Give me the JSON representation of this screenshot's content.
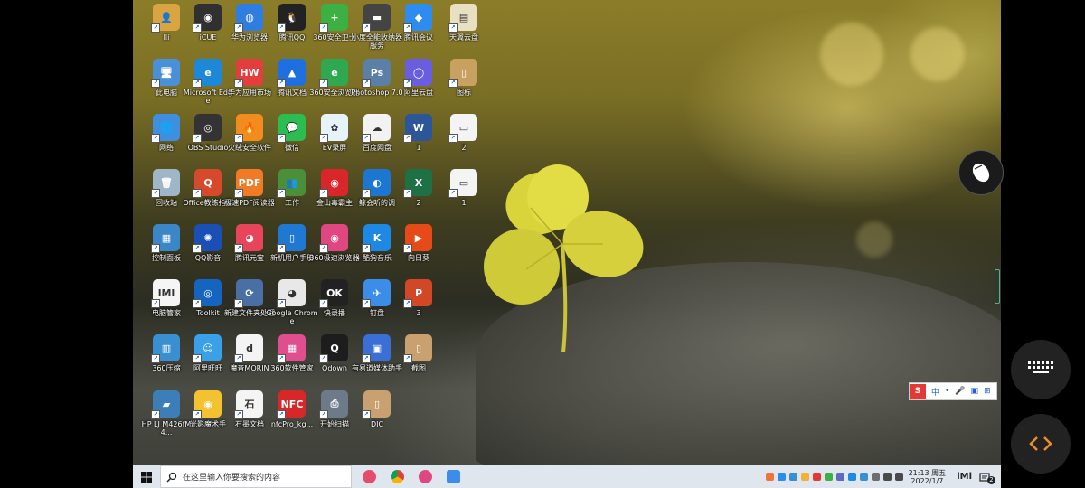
{
  "desktop": {
    "icons": [
      {
        "label": "lli",
        "color": "#d9a441",
        "glyph": "👤",
        "col": 0,
        "row": 0
      },
      {
        "label": "iCUE",
        "color": "#303030",
        "glyph": "◉",
        "col": 1,
        "row": 0
      },
      {
        "label": "华为浏览器",
        "color": "#2f7de1",
        "glyph": "◍",
        "col": 2,
        "row": 0
      },
      {
        "label": "腾讯QQ",
        "color": "#222222",
        "glyph": "🐧",
        "col": 3,
        "row": 0
      },
      {
        "label": "360安全卫士",
        "color": "#3cb043",
        "glyph": "+",
        "col": 4,
        "row": 0
      },
      {
        "label": "小度全能收纳器服务",
        "color": "#444444",
        "glyph": "▬",
        "col": 5,
        "row": 0
      },
      {
        "label": "腾讯会议",
        "color": "#2d8cf0",
        "glyph": "◆",
        "col": 6,
        "row": 0
      },
      {
        "label": "天翼云盘",
        "color": "#e8e0c0",
        "glyph": "▤",
        "col": 7,
        "row": 0
      },
      {
        "label": "此电脑",
        "color": "#4a90d9",
        "glyph": "🖥",
        "col": 0,
        "row": 1
      },
      {
        "label": "Microsoft Edge",
        "color": "#1b88d8",
        "glyph": "e",
        "col": 1,
        "row": 1
      },
      {
        "label": "华为应用市场",
        "color": "#e43d3d",
        "glyph": "HW",
        "col": 2,
        "row": 1
      },
      {
        "label": "腾讯文档",
        "color": "#1e6fe0",
        "glyph": "▲",
        "col": 3,
        "row": 1
      },
      {
        "label": "360安全浏览器",
        "color": "#2fa84f",
        "glyph": "e",
        "col": 4,
        "row": 1
      },
      {
        "label": "Photoshop 7.0",
        "color": "#5b7fa6",
        "glyph": "Ps",
        "col": 5,
        "row": 1
      },
      {
        "label": "阿里云盘",
        "color": "#6b5de0",
        "glyph": "◯",
        "col": 6,
        "row": 1
      },
      {
        "label": "图标",
        "color": "#c8a060",
        "glyph": "▯",
        "col": 7,
        "row": 1
      },
      {
        "label": "网络",
        "color": "#3f8fe0",
        "glyph": "🌐",
        "col": 0,
        "row": 2
      },
      {
        "label": "OBS Studio",
        "color": "#333333",
        "glyph": "◎",
        "col": 1,
        "row": 2
      },
      {
        "label": "火绒安全软件",
        "color": "#f28c1e",
        "glyph": "🔥",
        "col": 2,
        "row": 2
      },
      {
        "label": "微信",
        "color": "#2bbd52",
        "glyph": "💬",
        "col": 3,
        "row": 2
      },
      {
        "label": "EV录屏",
        "color": "#e6f3fa",
        "glyph": "✿",
        "col": 4,
        "row": 2
      },
      {
        "label": "百度网盘",
        "color": "#f2f2f2",
        "glyph": "☁",
        "col": 5,
        "row": 2
      },
      {
        "label": "1",
        "color": "#2b579a",
        "glyph": "W",
        "col": 6,
        "row": 2
      },
      {
        "label": "2",
        "color": "#f4f4f4",
        "glyph": "▭",
        "col": 7,
        "row": 2
      },
      {
        "label": "回收站",
        "color": "#9fb6c9",
        "glyph": "🗑",
        "col": 0,
        "row": 3
      },
      {
        "label": "Office教练指导",
        "color": "#d64a2b",
        "glyph": "Q",
        "col": 1,
        "row": 3
      },
      {
        "label": "极速PDF阅读器",
        "color": "#f07a25",
        "glyph": "PDF",
        "col": 2,
        "row": 3
      },
      {
        "label": "工作",
        "color": "#4b8f3a",
        "glyph": "👥",
        "col": 3,
        "row": 3
      },
      {
        "label": "金山毒霸主",
        "color": "#d9262b",
        "glyph": "◉",
        "col": 4,
        "row": 3
      },
      {
        "label": "鲸会听的调",
        "color": "#1d76d2",
        "glyph": "◐",
        "col": 5,
        "row": 3
      },
      {
        "label": "2",
        "color": "#1e7145",
        "glyph": "X",
        "col": 6,
        "row": 3
      },
      {
        "label": "1",
        "color": "#f4f4f4",
        "glyph": "▭",
        "col": 7,
        "row": 3
      },
      {
        "label": "控制面板",
        "color": "#3b86c7",
        "glyph": "▦",
        "col": 0,
        "row": 4
      },
      {
        "label": "QQ影音",
        "color": "#1a4fb5",
        "glyph": "✺",
        "col": 1,
        "row": 4
      },
      {
        "label": "腾讯元宝",
        "color": "#e8455c",
        "glyph": "◕",
        "col": 2,
        "row": 4
      },
      {
        "label": "新机用户手册",
        "color": "#1f78d1",
        "glyph": "▯",
        "col": 3,
        "row": 4
      },
      {
        "label": "360极速浏览器",
        "color": "#e0467f",
        "glyph": "◉",
        "col": 4,
        "row": 4
      },
      {
        "label": "酷狗音乐",
        "color": "#1e88e5",
        "glyph": "K",
        "col": 5,
        "row": 4
      },
      {
        "label": "向日葵",
        "color": "#e64a19",
        "glyph": "▶",
        "col": 6,
        "row": 4
      },
      {
        "label": "电脑管家",
        "color": "#f5f5f5",
        "glyph": "lMl",
        "col": 0,
        "row": 5
      },
      {
        "label": "Toolkit",
        "color": "#1565c0",
        "glyph": "◎",
        "col": 1,
        "row": 5
      },
      {
        "label": "新建文件夹处理",
        "color": "#4a6fa5",
        "glyph": "⟳",
        "col": 2,
        "row": 5
      },
      {
        "label": "Google Chrome",
        "color": "#e8e8e8",
        "glyph": "◕",
        "col": 3,
        "row": 5
      },
      {
        "label": "快录播",
        "color": "#222222",
        "glyph": "OK",
        "col": 4,
        "row": 5
      },
      {
        "label": "钉盘",
        "color": "#3c8de8",
        "glyph": "✈",
        "col": 5,
        "row": 5
      },
      {
        "label": "3",
        "color": "#d24726",
        "glyph": "P",
        "col": 6,
        "row": 5
      },
      {
        "label": "360压缩",
        "color": "#3a8fd1",
        "glyph": "▥",
        "col": 0,
        "row": 6
      },
      {
        "label": "阿里旺旺",
        "color": "#3aa0e8",
        "glyph": "☺",
        "col": 1,
        "row": 6
      },
      {
        "label": "魔音MORIN",
        "color": "#f4f4f4",
        "glyph": "d",
        "col": 2,
        "row": 6
      },
      {
        "label": "360软件管家",
        "color": "#e04e8f",
        "glyph": "▦",
        "col": 3,
        "row": 6
      },
      {
        "label": "Qdown",
        "color": "#1d1d1d",
        "glyph": "Q",
        "col": 4,
        "row": 6
      },
      {
        "label": "有易道媒体助手",
        "color": "#3b6fd6",
        "glyph": "▣",
        "col": 5,
        "row": 6
      },
      {
        "label": "截图",
        "color": "#c9a070",
        "glyph": "▯",
        "col": 6,
        "row": 6
      },
      {
        "label": "HP LJ M426fM4...",
        "color": "#3c7fb8",
        "glyph": "▰",
        "col": 0,
        "row": 7
      },
      {
        "label": "光影魔术手",
        "color": "#f2c230",
        "glyph": "◉",
        "col": 1,
        "row": 7
      },
      {
        "label": "石墨文档",
        "color": "#f4f4f4",
        "glyph": "石",
        "col": 2,
        "row": 7
      },
      {
        "label": "nfcPro_kg...",
        "color": "#d62828",
        "glyph": "NFC",
        "col": 3,
        "row": 7
      },
      {
        "label": "开始扫描",
        "color": "#6c7a89",
        "glyph": "⎙",
        "col": 4,
        "row": 7
      },
      {
        "label": "DIC",
        "color": "#c9a070",
        "glyph": "▯",
        "col": 5,
        "row": 7
      }
    ]
  },
  "taskbar": {
    "search_placeholder": "在这里输入你要搜索的内容",
    "apps": [
      {
        "name": "app-1",
        "color": "#e54b6b"
      },
      {
        "name": "chrome",
        "color": "#e8e8e8"
      },
      {
        "name": "360-browser",
        "color": "#e0467f"
      },
      {
        "name": "dingtalk",
        "color": "#3c8de8"
      }
    ],
    "time": "21:13 周五",
    "date": "2022/1/7",
    "notification_count": "2"
  },
  "ime": {
    "logo": "S",
    "mode": "中"
  }
}
